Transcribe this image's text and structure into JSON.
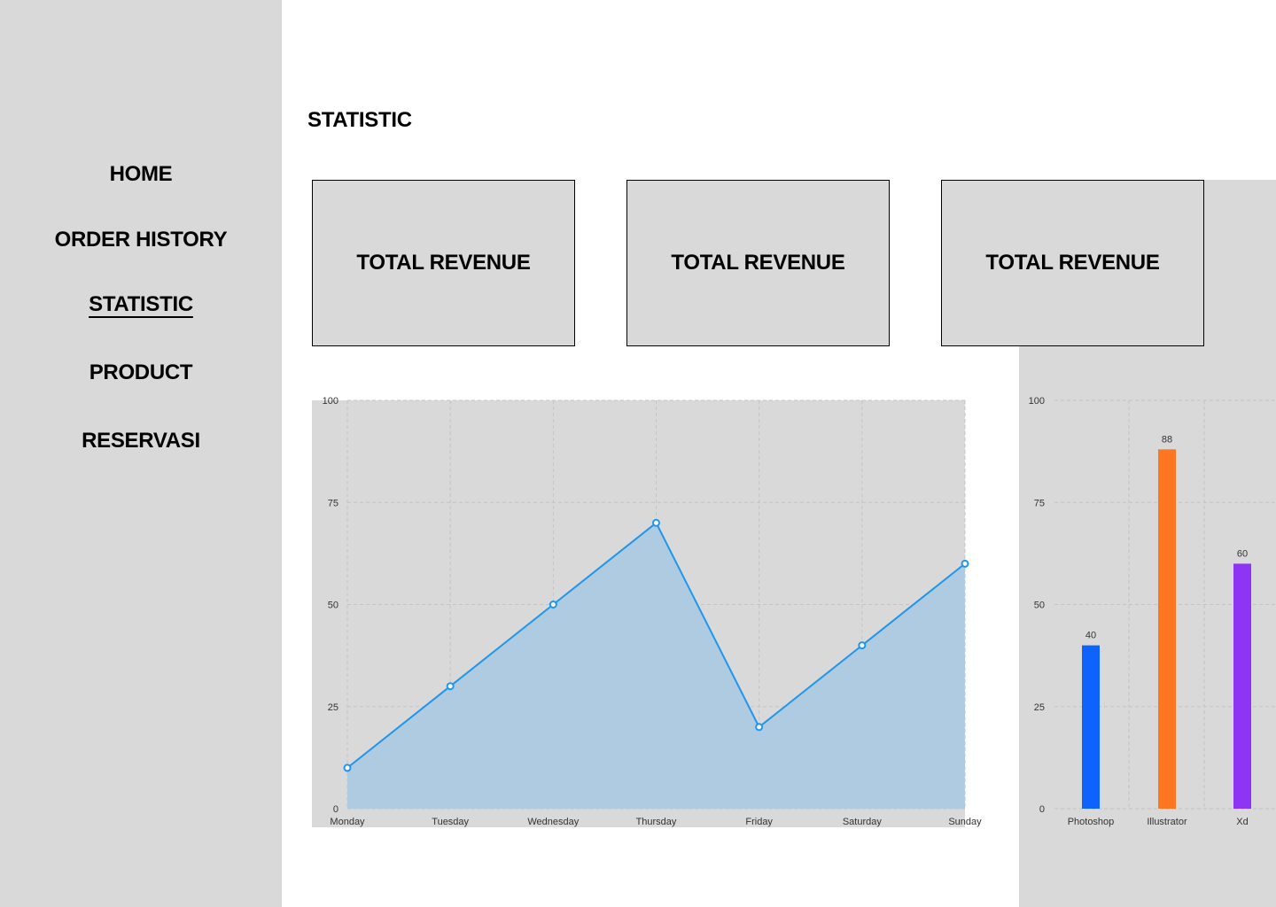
{
  "sidebar": {
    "items": [
      {
        "label": "HOME",
        "active": false
      },
      {
        "label": "ORDER HISTORY",
        "active": false
      },
      {
        "label": "STATISTIC",
        "active": true
      },
      {
        "label": "PRODUCT",
        "active": false
      },
      {
        "label": "RESERVASI",
        "active": false
      }
    ]
  },
  "main": {
    "title": "STATISTIC",
    "cards": [
      {
        "label": "TOTAL REVENUE"
      },
      {
        "label": "TOTAL REVENUE"
      },
      {
        "label": "TOTAL REVENUE"
      }
    ]
  },
  "chart_data": [
    {
      "type": "area",
      "categories": [
        "Monday",
        "Tuesday",
        "Wednesday",
        "Thursday",
        "Friday",
        "Saturday",
        "Sunday"
      ],
      "values": [
        10,
        30,
        50,
        70,
        20,
        40,
        60
      ],
      "ylim": [
        0,
        100
      ],
      "yticks": [
        0,
        25,
        50,
        75,
        100
      ],
      "grid": true,
      "colors": {
        "line": "#1e96f0",
        "fill": "#afcbe2",
        "background": "#d9d9d9"
      }
    },
    {
      "type": "bar",
      "categories": [
        "Photoshop",
        "Illustrator",
        "Xd"
      ],
      "values": [
        40,
        88,
        60
      ],
      "ylim": [
        0,
        100
      ],
      "yticks": [
        0,
        25,
        50,
        75,
        100
      ],
      "grid": true,
      "data_labels": true,
      "colors": [
        "#0d63fb",
        "#ff7622",
        "#8d34f5"
      ]
    }
  ]
}
